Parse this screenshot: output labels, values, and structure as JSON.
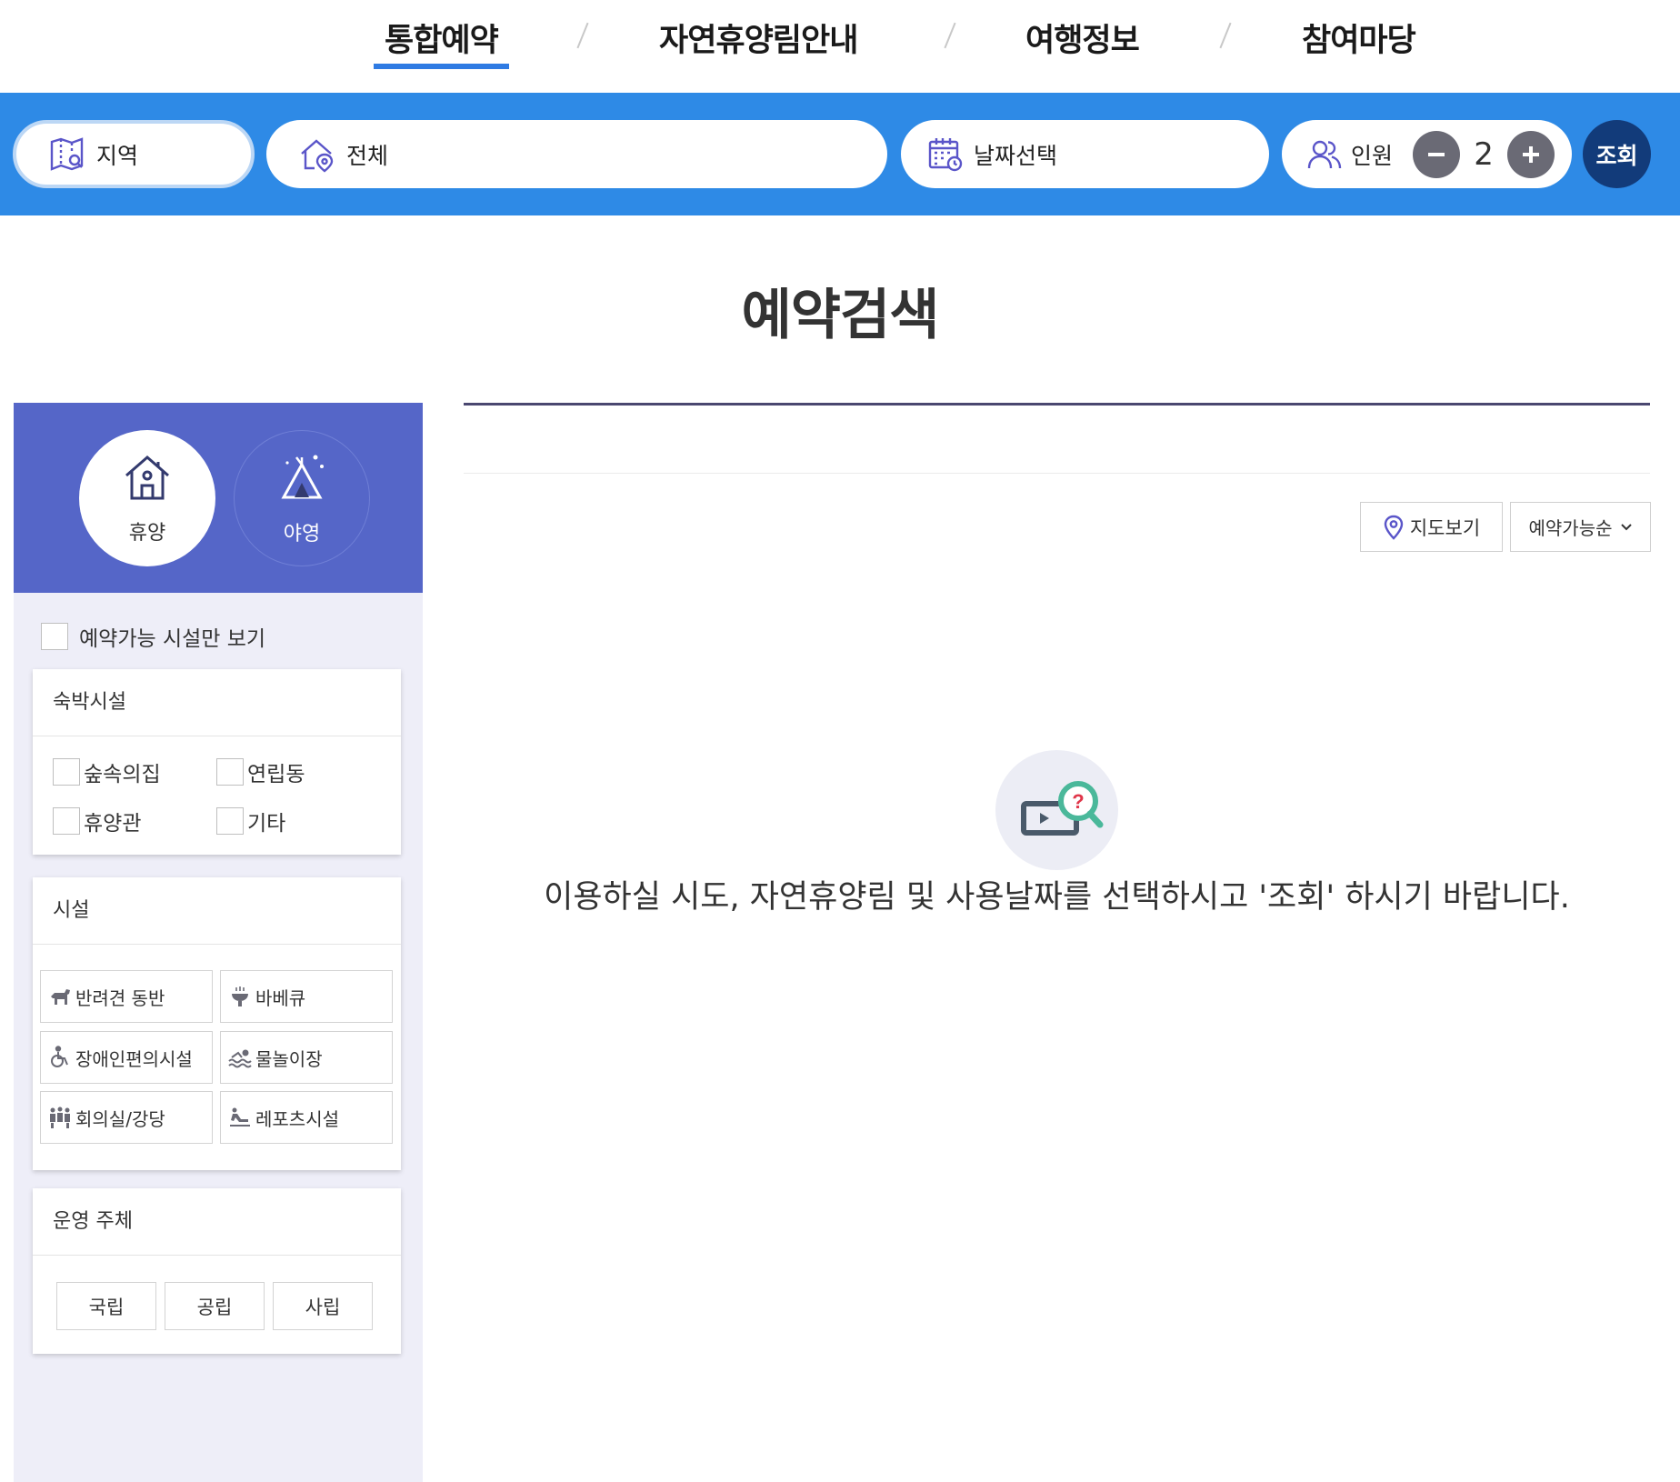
{
  "nav": {
    "items": [
      {
        "label": "통합예약",
        "active": true
      },
      {
        "label": "자연휴양림안내",
        "active": false
      },
      {
        "label": "여행정보",
        "active": false
      },
      {
        "label": "참여마당",
        "active": false
      }
    ]
  },
  "search": {
    "region_label": "지역",
    "area_label": "전체",
    "date_label": "날짜선택",
    "people_label": "인원",
    "people_count": "2",
    "minus_label": "−",
    "plus_label": "+",
    "query_label": "조회"
  },
  "page": {
    "title": "예약검색"
  },
  "filters": {
    "modes": [
      {
        "label": "휴양",
        "active": true
      },
      {
        "label": "야영",
        "active": false
      }
    ],
    "available_only_label": "예약가능 시설만 보기",
    "stay": {
      "title": "숙박시설",
      "options": [
        "숲속의집",
        "연립동",
        "휴양관",
        "기타"
      ]
    },
    "facility": {
      "title": "시설",
      "options": [
        {
          "label": "반려견 동반",
          "icon": "dog-icon"
        },
        {
          "label": "바베큐",
          "icon": "grill-icon"
        },
        {
          "label": "장애인편의시설",
          "icon": "wheelchair-icon"
        },
        {
          "label": "물놀이장",
          "icon": "swimming-icon"
        },
        {
          "label": "회의실/강당",
          "icon": "meeting-icon"
        },
        {
          "label": "레포츠시설",
          "icon": "leisure-icon"
        }
      ]
    },
    "operator": {
      "title": "운영 주체",
      "options": [
        "국립",
        "공립",
        "사립"
      ]
    }
  },
  "results": {
    "map_view_label": "지도보기",
    "sort_label": "예약가능순",
    "empty_message": "이용하실 시도, 자연휴양림 및 사용날짜를 선택하시고 '조회' 하시기 바랍니다."
  },
  "colors": {
    "nav_active_underline": "#2f7be3",
    "search_bar_bg": "#2e8ae6",
    "query_button_bg": "#123b7a",
    "filter_header_bg": "#5566c8",
    "filter_panel_bg": "#eeeef8",
    "icon_accent": "#5a55c9"
  }
}
